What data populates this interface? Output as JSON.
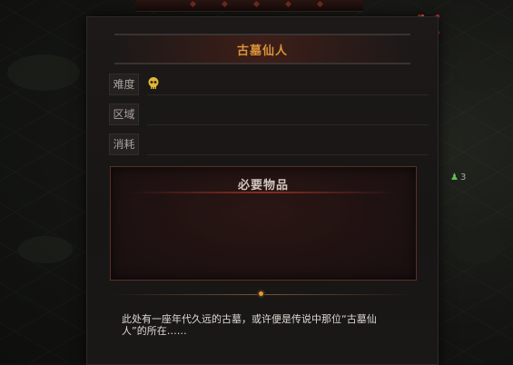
{
  "dialog": {
    "title": "古墓仙人",
    "fields": {
      "difficulty_label": "难度",
      "area_label": "区域",
      "cost_label": "消耗"
    },
    "difficulty_icon": "gold-skull-icon",
    "required_items_title": "必要物品",
    "description": "此处有一座年代久远的古墓，或许便是传说中那位“古墓仙人”的所在……",
    "close_icon": "close-x-icon"
  },
  "map": {
    "side_badge_count": "3"
  },
  "colors": {
    "title": "#d9933a",
    "close": "#d8322c",
    "skull": "#e0b83a",
    "items_border": "#5b2e27",
    "gem": "#e69a2e"
  }
}
